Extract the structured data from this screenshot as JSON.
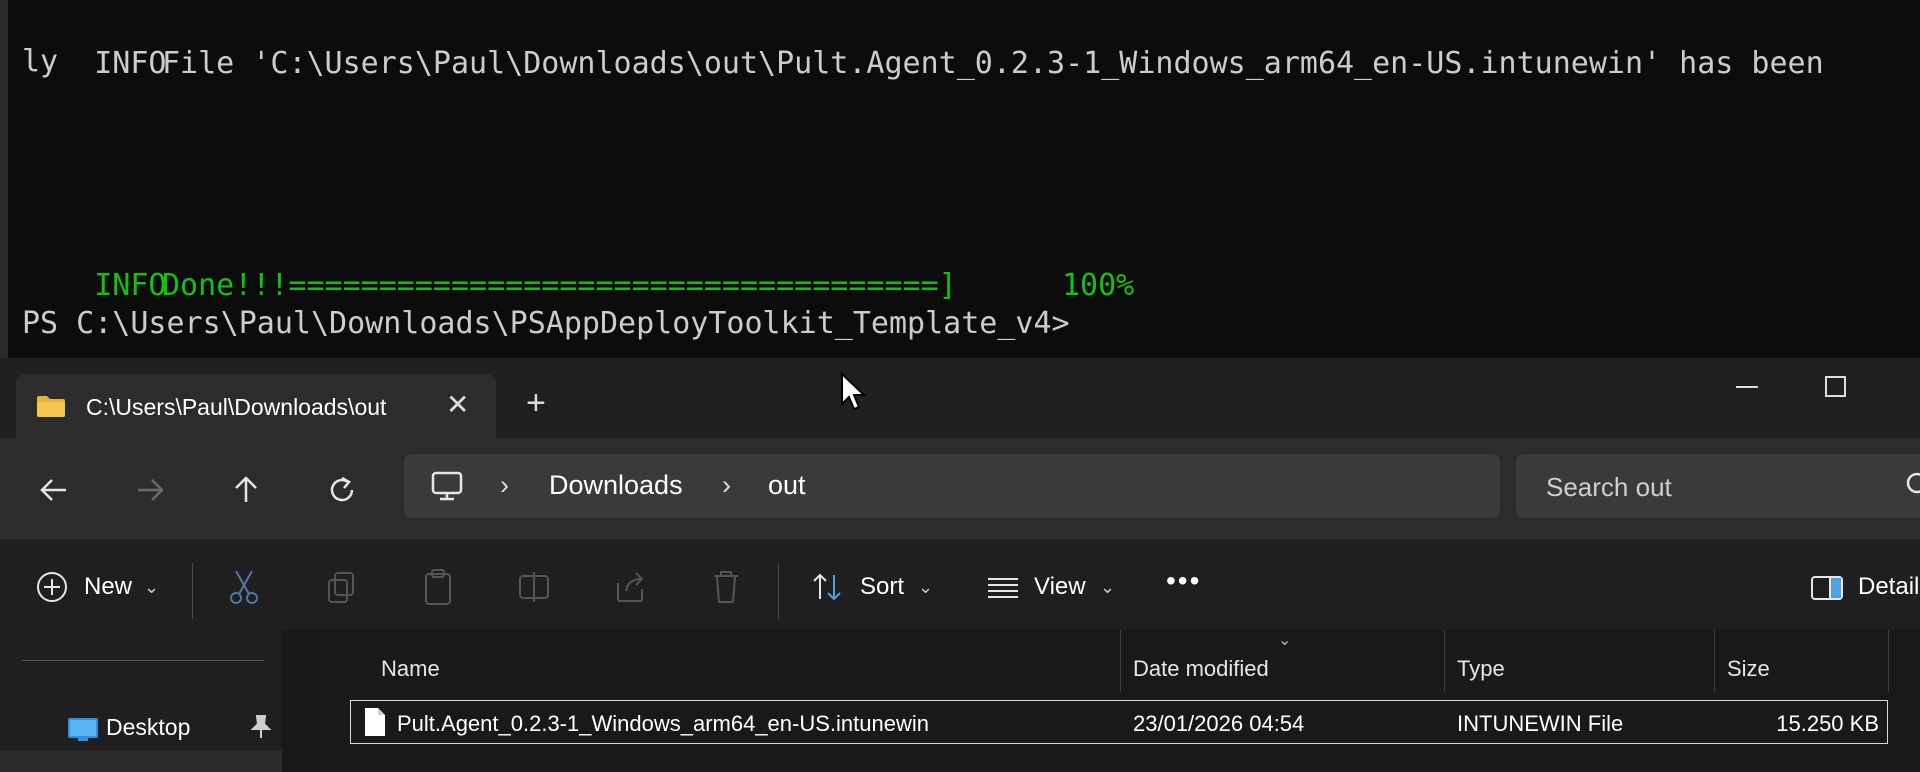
{
  "terminal": {
    "line1_level": "INFO",
    "line1_text": "File 'C:\\Users\\Paul\\Downloads\\out\\Pult.Agent_0.2.3-1_Windows_arm64_en-US.intunewin' has been",
    "line2_text": "ly",
    "done_level": "INFO",
    "done_text": "Done!!!====================================]",
    "done_percent": "100%",
    "prompt": "PS C:\\Users\\Paul\\Downloads\\PSAppDeployToolkit_Template_v4>",
    "colors": {
      "text": "#cccccc",
      "success": "#13c10e"
    }
  },
  "explorer": {
    "tab_title": "C:\\Users\\Paul\\Downloads\\out",
    "breadcrumbs": [
      "Downloads",
      "out"
    ],
    "search_placeholder": "Search out",
    "toolbar": {
      "new_label": "New",
      "sort_label": "Sort",
      "view_label": "View",
      "details_label": "Detail"
    },
    "nav": {
      "desktop_label": "Desktop"
    },
    "columns": [
      "Name",
      "Date modified",
      "Type",
      "Size"
    ],
    "rows": [
      {
        "name": "Pult.Agent_0.2.3-1_Windows_arm64_en-US.intunewin",
        "date": "23/01/2026 04:54",
        "type": "INTUNEWIN File",
        "size": "15.250 KB"
      }
    ],
    "icons": {
      "tab": "folder-icon",
      "close": "close-icon",
      "new_tab": "plus-icon",
      "back": "arrow-left-icon",
      "forward": "arrow-right-icon",
      "up": "arrow-up-icon",
      "refresh": "refresh-icon",
      "pc": "monitor-icon",
      "search": "search-icon",
      "cut": "scissors-icon",
      "copy": "copy-icon",
      "paste": "clipboard-icon",
      "rename": "rename-icon",
      "share": "share-icon",
      "delete": "trash-icon",
      "more": "more-icon",
      "details": "details-pane-icon",
      "pin": "pin-icon",
      "file": "file-icon"
    },
    "colors": {
      "accent_folder": "#e8b33a",
      "background": "#202020",
      "selection_border": "#d8d8d8"
    }
  }
}
